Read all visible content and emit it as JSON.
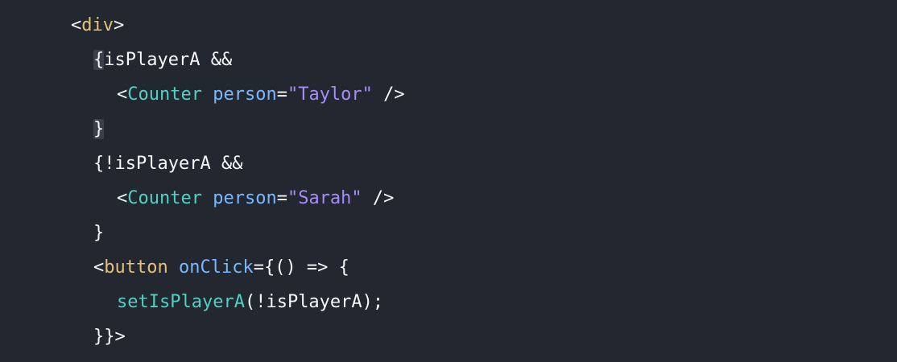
{
  "code": {
    "lines": [
      [
        {
          "t": "<",
          "c": "c-punct"
        },
        {
          "t": "div",
          "c": "c-tag-builtin"
        },
        {
          "t": ">",
          "c": "c-punct"
        }
      ],
      [
        {
          "t": "{",
          "c": "c-punct bracket-hl"
        },
        {
          "t": "isPlayerA",
          "c": "c-ident"
        },
        {
          "t": " &&",
          "c": "c-punct"
        }
      ],
      [
        {
          "t": "<",
          "c": "c-punct"
        },
        {
          "t": "Counter",
          "c": "c-tag-comp"
        },
        {
          "t": " ",
          "c": "c-punct"
        },
        {
          "t": "person",
          "c": "c-attr"
        },
        {
          "t": "=",
          "c": "c-punct"
        },
        {
          "t": "\"Taylor\"",
          "c": "c-string"
        },
        {
          "t": " />",
          "c": "c-punct"
        }
      ],
      [
        {
          "t": "}",
          "c": "c-punct bracket-hl"
        }
      ],
      [
        {
          "t": "{!",
          "c": "c-punct"
        },
        {
          "t": "isPlayerA",
          "c": "c-ident"
        },
        {
          "t": " &&",
          "c": "c-punct"
        }
      ],
      [
        {
          "t": "<",
          "c": "c-punct"
        },
        {
          "t": "Counter",
          "c": "c-tag-comp"
        },
        {
          "t": " ",
          "c": "c-punct"
        },
        {
          "t": "person",
          "c": "c-attr"
        },
        {
          "t": "=",
          "c": "c-punct"
        },
        {
          "t": "\"Sarah\"",
          "c": "c-string"
        },
        {
          "t": " />",
          "c": "c-punct"
        }
      ],
      [
        {
          "t": "}",
          "c": "c-punct"
        }
      ],
      [
        {
          "t": "<",
          "c": "c-punct"
        },
        {
          "t": "button",
          "c": "c-tag-builtin"
        },
        {
          "t": " ",
          "c": "c-punct"
        },
        {
          "t": "onClick",
          "c": "c-attr"
        },
        {
          "t": "={() => {",
          "c": "c-punct"
        }
      ],
      [
        {
          "t": "setIsPlayerA",
          "c": "c-fn"
        },
        {
          "t": "(!",
          "c": "c-punct"
        },
        {
          "t": "isPlayerA",
          "c": "c-ident"
        },
        {
          "t": ");",
          "c": "c-punct"
        }
      ],
      [
        {
          "t": "}}>",
          "c": "c-punct"
        }
      ]
    ]
  },
  "colors": {
    "background": "#23272f",
    "text": "#f6f7f9",
    "html_tag": "#e5c07b",
    "component_tag": "#4fd1c5",
    "attribute": "#79b8ff",
    "string": "#a78bfa",
    "bracket_highlight": "#3a3f4b"
  }
}
